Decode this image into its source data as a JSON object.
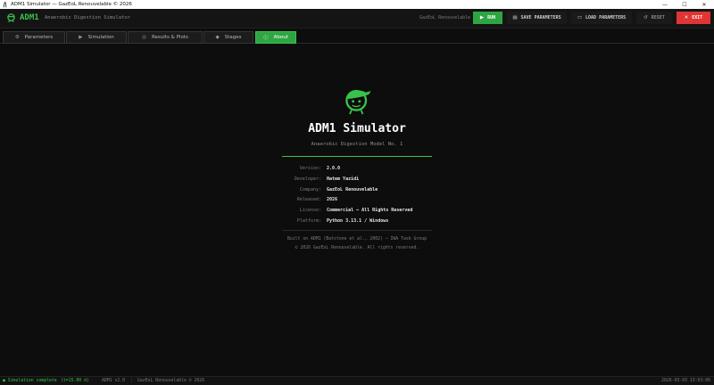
{
  "window": {
    "title": "ADM1 Simulator  —  GazEoL Renouvelable © 2026",
    "controls": [
      "—",
      "☐",
      "✕"
    ]
  },
  "header": {
    "brand": "ADM1",
    "subtitle": "Anaerobic Digestion Simulator",
    "company": "GazEoL Renouvelable",
    "buttons": {
      "run": "RUN",
      "save": "SAVE PARAMETERS",
      "load": "LOAD PARAMETERS",
      "reset": "RESET",
      "exit": "EXIT"
    },
    "icons": {
      "run": "▶",
      "save": "▤",
      "load": "▭",
      "reset": "↺",
      "exit": "✕"
    }
  },
  "tabs": [
    {
      "label": "Parameters",
      "icon": "⚙"
    },
    {
      "label": "Simulation",
      "icon": "▶"
    },
    {
      "label": "Results & Plots",
      "icon": "◎"
    },
    {
      "label": "Stages",
      "icon": "◆"
    },
    {
      "label": "About",
      "icon": "ⓘ",
      "active": true
    }
  ],
  "about": {
    "title": "ADM1 Simulator",
    "subtitle": "Anaerobic Digestion Model No. 1",
    "rows": [
      {
        "key": "Version:",
        "value": "2.0.0"
      },
      {
        "key": "Developer:",
        "value": "Hatem Yazidi"
      },
      {
        "key": "Company:",
        "value": "GazEoL Renouvelable"
      },
      {
        "key": "Released:",
        "value": "2026"
      },
      {
        "key": "License:",
        "value": "Commercial — All Rights Reserved"
      },
      {
        "key": "Platform:",
        "value": "Python 3.13.1  /  Windows"
      }
    ],
    "credit_line1": "Built on ADM1 (Batstone et al., 2002) — IWA Task Group",
    "credit_line2": "© 2026 GazEoL Renouvelable. All rights reserved."
  },
  "status": {
    "message": "● Simulation complete",
    "time": "(t=15.00 d)",
    "version": "ADM1 v2.0",
    "separator": "|",
    "copyright": "GazEoL Renouvelable © 2026",
    "datetime": "2026-03-03  13:03:06"
  },
  "colors": {
    "accent": "#39c24a",
    "run": "#2ea543",
    "exit": "#e03535",
    "background": "#0d0d0d"
  }
}
